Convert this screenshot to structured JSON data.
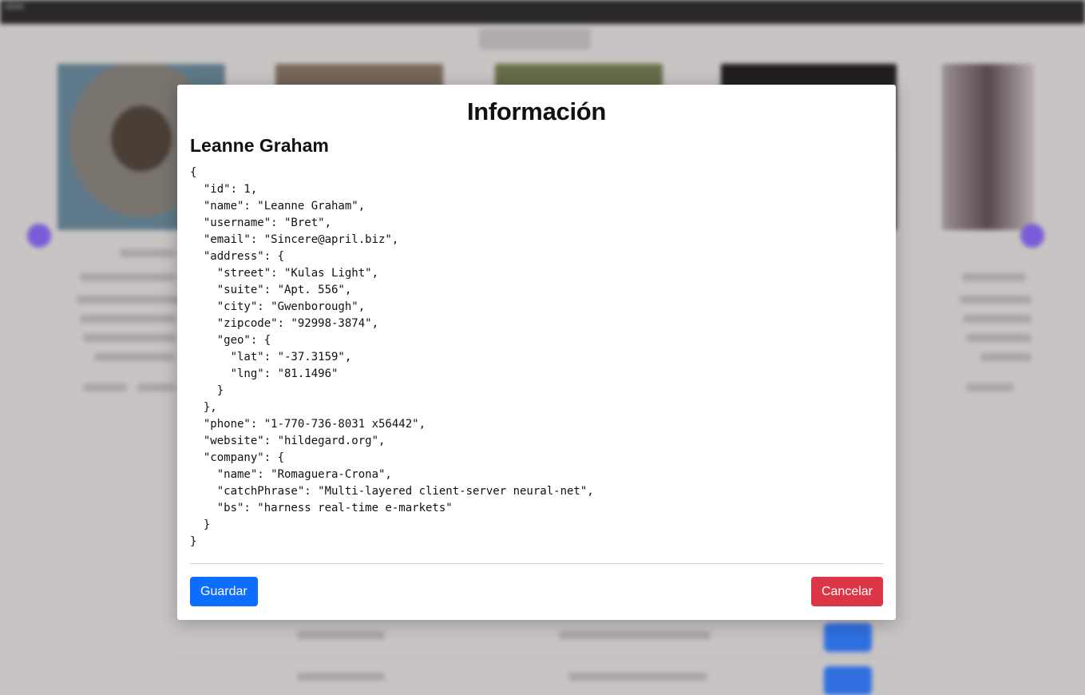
{
  "modal": {
    "title": "Información",
    "user_name": "Leanne Graham",
    "json_text": "{\n  \"id\": 1,\n  \"name\": \"Leanne Graham\",\n  \"username\": \"Bret\",\n  \"email\": \"Sincere@april.biz\",\n  \"address\": {\n    \"street\": \"Kulas Light\",\n    \"suite\": \"Apt. 556\",\n    \"city\": \"Gwenborough\",\n    \"zipcode\": \"92998-3874\",\n    \"geo\": {\n      \"lat\": \"-37.3159\",\n      \"lng\": \"81.1496\"\n    }\n  },\n  \"phone\": \"1-770-736-8031 x56442\",\n  \"website\": \"hildegard.org\",\n  \"company\": {\n    \"name\": \"Romaguera-Crona\",\n    \"catchPhrase\": \"Multi-layered client-server neural-net\",\n    \"bs\": \"harness real-time e-markets\"\n  }\n}",
    "save_label": "Guardar",
    "cancel_label": "Cancelar"
  },
  "colors": {
    "primary": "#0d6efd",
    "danger": "#dc3545",
    "backdrop": "#c9c4c4"
  }
}
